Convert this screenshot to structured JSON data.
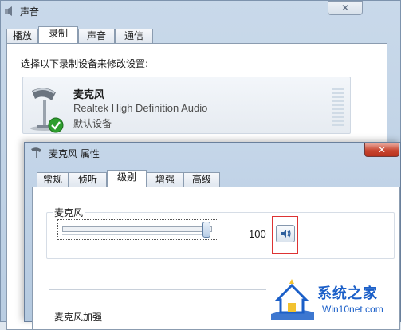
{
  "sound_window": {
    "title": "声音",
    "tabs": [
      {
        "label": "播放"
      },
      {
        "label": "录制",
        "active": true
      },
      {
        "label": "声音"
      },
      {
        "label": "通信"
      }
    ],
    "instruction": "选择以下录制设备来修改设置:",
    "device": {
      "name": "麦克风",
      "driver": "Realtek High Definition Audio",
      "status": "默认设备"
    }
  },
  "properties_window": {
    "title": "麦克风 属性",
    "tabs": [
      {
        "label": "常规"
      },
      {
        "label": "侦听"
      },
      {
        "label": "级别",
        "active": true
      },
      {
        "label": "增强"
      },
      {
        "label": "高级"
      }
    ],
    "microphone_label": "麦克风",
    "level_value": "100",
    "level_fraction": 1.0,
    "boost_label": "麦克风加强"
  },
  "watermark": {
    "brand": "系统之家",
    "site": "Win10net.com"
  },
  "colors": {
    "highlight_box": "#dd3333",
    "close_button": "#c8452f",
    "default_check": "#2e9e2e",
    "watermark": "#1b5fc8"
  },
  "icons": {
    "sound_title": "speaker-icon",
    "device": "microphone-icon",
    "default_badge": "green-check-icon",
    "properties_title": "microphone-icon",
    "mute": "speaker-volume-icon",
    "close": "close-icon"
  }
}
